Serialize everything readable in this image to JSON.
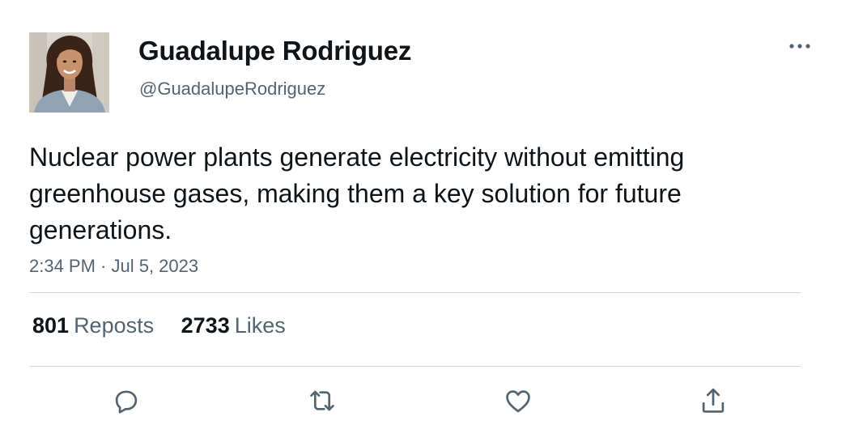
{
  "author": {
    "display_name": "Guadalupe Rodriguez",
    "handle": "@GuadalupeRodriguez"
  },
  "tweet": {
    "text": "Nuclear power plants generate electricity without emitting greenhouse gases, making them a key solution for future generations.",
    "timestamp": "2:34 PM · Jul 5, 2023"
  },
  "stats": {
    "reposts_count": "801",
    "reposts_label": "Reposts",
    "likes_count": "2733",
    "likes_label": "Likes"
  },
  "actions": {
    "reply_icon": "reply-icon",
    "repost_icon": "repost-icon",
    "like_icon": "like-icon",
    "share_icon": "share-icon",
    "more_icon": "more-options-icon"
  },
  "colors": {
    "text_primary": "#0f1419",
    "text_secondary": "#536471",
    "divider": "#cfd9de"
  }
}
